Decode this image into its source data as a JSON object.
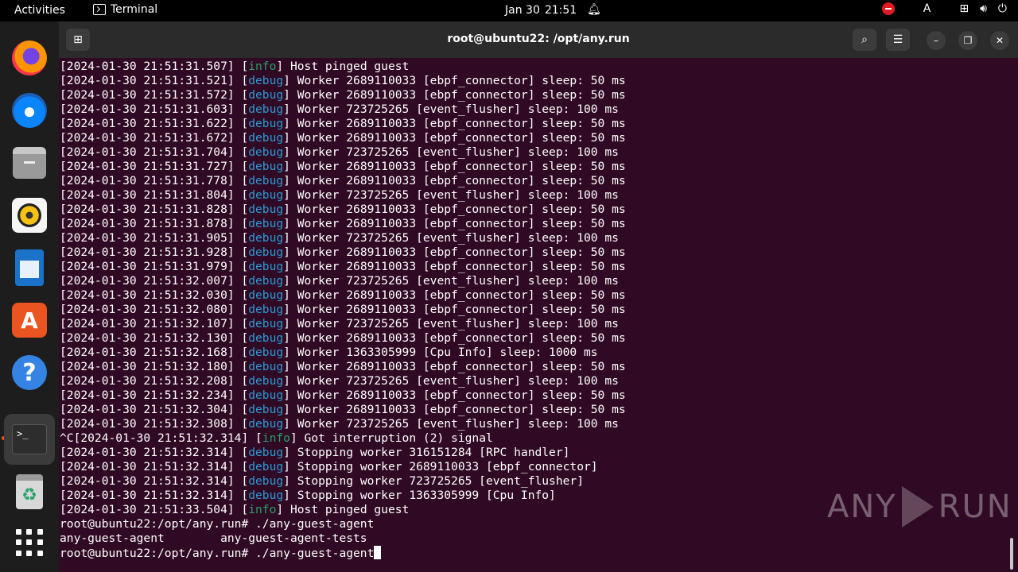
{
  "topbar": {
    "activities": "Activities",
    "app_name": "Terminal",
    "date": "Jan 30",
    "time": "21:51",
    "keyboard_layout": "A"
  },
  "window": {
    "title": "root@ubuntu22: /opt/any.run"
  },
  "terminal": {
    "lines": [
      {
        "pre": "[2024-01-30 21:51:31.507] [",
        "tag": "info",
        "post": "] Host pinged guest"
      },
      {
        "pre": "[2024-01-30 21:51:31.521] [",
        "tag": "debug",
        "post": "] Worker 2689110033 [ebpf_connector] sleep: 50 ms"
      },
      {
        "pre": "[2024-01-30 21:51:31.572] [",
        "tag": "debug",
        "post": "] Worker 2689110033 [ebpf_connector] sleep: 50 ms"
      },
      {
        "pre": "[2024-01-30 21:51:31.603] [",
        "tag": "debug",
        "post": "] Worker 723725265 [event_flusher] sleep: 100 ms"
      },
      {
        "pre": "[2024-01-30 21:51:31.622] [",
        "tag": "debug",
        "post": "] Worker 2689110033 [ebpf_connector] sleep: 50 ms"
      },
      {
        "pre": "[2024-01-30 21:51:31.672] [",
        "tag": "debug",
        "post": "] Worker 2689110033 [ebpf_connector] sleep: 50 ms"
      },
      {
        "pre": "[2024-01-30 21:51:31.704] [",
        "tag": "debug",
        "post": "] Worker 723725265 [event_flusher] sleep: 100 ms"
      },
      {
        "pre": "[2024-01-30 21:51:31.727] [",
        "tag": "debug",
        "post": "] Worker 2689110033 [ebpf_connector] sleep: 50 ms"
      },
      {
        "pre": "[2024-01-30 21:51:31.778] [",
        "tag": "debug",
        "post": "] Worker 2689110033 [ebpf_connector] sleep: 50 ms"
      },
      {
        "pre": "[2024-01-30 21:51:31.804] [",
        "tag": "debug",
        "post": "] Worker 723725265 [event_flusher] sleep: 100 ms"
      },
      {
        "pre": "[2024-01-30 21:51:31.828] [",
        "tag": "debug",
        "post": "] Worker 2689110033 [ebpf_connector] sleep: 50 ms"
      },
      {
        "pre": "[2024-01-30 21:51:31.878] [",
        "tag": "debug",
        "post": "] Worker 2689110033 [ebpf_connector] sleep: 50 ms"
      },
      {
        "pre": "[2024-01-30 21:51:31.905] [",
        "tag": "debug",
        "post": "] Worker 723725265 [event_flusher] sleep: 100 ms"
      },
      {
        "pre": "[2024-01-30 21:51:31.928] [",
        "tag": "debug",
        "post": "] Worker 2689110033 [ebpf_connector] sleep: 50 ms"
      },
      {
        "pre": "[2024-01-30 21:51:31.979] [",
        "tag": "debug",
        "post": "] Worker 2689110033 [ebpf_connector] sleep: 50 ms"
      },
      {
        "pre": "[2024-01-30 21:51:32.007] [",
        "tag": "debug",
        "post": "] Worker 723725265 [event_flusher] sleep: 100 ms"
      },
      {
        "pre": "[2024-01-30 21:51:32.030] [",
        "tag": "debug",
        "post": "] Worker 2689110033 [ebpf_connector] sleep: 50 ms"
      },
      {
        "pre": "[2024-01-30 21:51:32.080] [",
        "tag": "debug",
        "post": "] Worker 2689110033 [ebpf_connector] sleep: 50 ms"
      },
      {
        "pre": "[2024-01-30 21:51:32.107] [",
        "tag": "debug",
        "post": "] Worker 723725265 [event_flusher] sleep: 100 ms"
      },
      {
        "pre": "[2024-01-30 21:51:32.130] [",
        "tag": "debug",
        "post": "] Worker 2689110033 [ebpf_connector] sleep: 50 ms"
      },
      {
        "pre": "[2024-01-30 21:51:32.168] [",
        "tag": "debug",
        "post": "] Worker 1363305999 [Cpu Info] sleep: 1000 ms"
      },
      {
        "pre": "[2024-01-30 21:51:32.180] [",
        "tag": "debug",
        "post": "] Worker 2689110033 [ebpf_connector] sleep: 50 ms"
      },
      {
        "pre": "[2024-01-30 21:51:32.208] [",
        "tag": "debug",
        "post": "] Worker 723725265 [event_flusher] sleep: 100 ms"
      },
      {
        "pre": "[2024-01-30 21:51:32.234] [",
        "tag": "debug",
        "post": "] Worker 2689110033 [ebpf_connector] sleep: 50 ms"
      },
      {
        "pre": "[2024-01-30 21:51:32.304] [",
        "tag": "debug",
        "post": "] Worker 2689110033 [ebpf_connector] sleep: 50 ms"
      },
      {
        "pre": "[2024-01-30 21:51:32.308] [",
        "tag": "debug",
        "post": "] Worker 723725265 [event_flusher] sleep: 100 ms"
      },
      {
        "pre": "^C[2024-01-30 21:51:32.314] [",
        "tag": "info",
        "post": "] Got interruption (2) signal"
      },
      {
        "pre": "[2024-01-30 21:51:32.314] [",
        "tag": "debug",
        "post": "] Stopping worker 316151284 [RPC handler]"
      },
      {
        "pre": "[2024-01-30 21:51:32.314] [",
        "tag": "debug",
        "post": "] Stopping worker 2689110033 [ebpf_connector]"
      },
      {
        "pre": "[2024-01-30 21:51:32.314] [",
        "tag": "debug",
        "post": "] Stopping worker 723725265 [event_flusher]"
      },
      {
        "pre": "[2024-01-30 21:51:32.314] [",
        "tag": "debug",
        "post": "] Stopping worker 1363305999 [Cpu Info]"
      },
      {
        "pre": "[2024-01-30 21:51:33.504] [",
        "tag": "info",
        "post": "] Host pinged guest"
      },
      {
        "pre": "root@ubuntu22:/opt/any.run# ./any-guest-agent",
        "tag": "",
        "post": ""
      },
      {
        "pre": "any-guest-agent        any-guest-agent-tests",
        "tag": "",
        "post": ""
      },
      {
        "pre": "root@ubuntu22:/opt/any.run# ./any-guest-agent",
        "tag": "",
        "post": "",
        "cursor": true
      }
    ]
  },
  "watermark": {
    "left": "ANY",
    "right": "RUN"
  },
  "colors": {
    "terminal_bg": "#300a24",
    "info_tag": "#26a269",
    "debug_tag": "#2a9bd6",
    "accent": "#e95420"
  },
  "dock": {
    "items": [
      "firefox-icon",
      "thunderbird-icon",
      "files-icon",
      "rhythmbox-icon",
      "libreoffice-writer-icon",
      "app-center-icon",
      "help-icon",
      "terminal-icon",
      "trash-icon",
      "show-apps-icon"
    ],
    "store_glyph": "A",
    "help_glyph": "?",
    "terminal_glyph": ">_",
    "trash_glyph": "♻"
  }
}
